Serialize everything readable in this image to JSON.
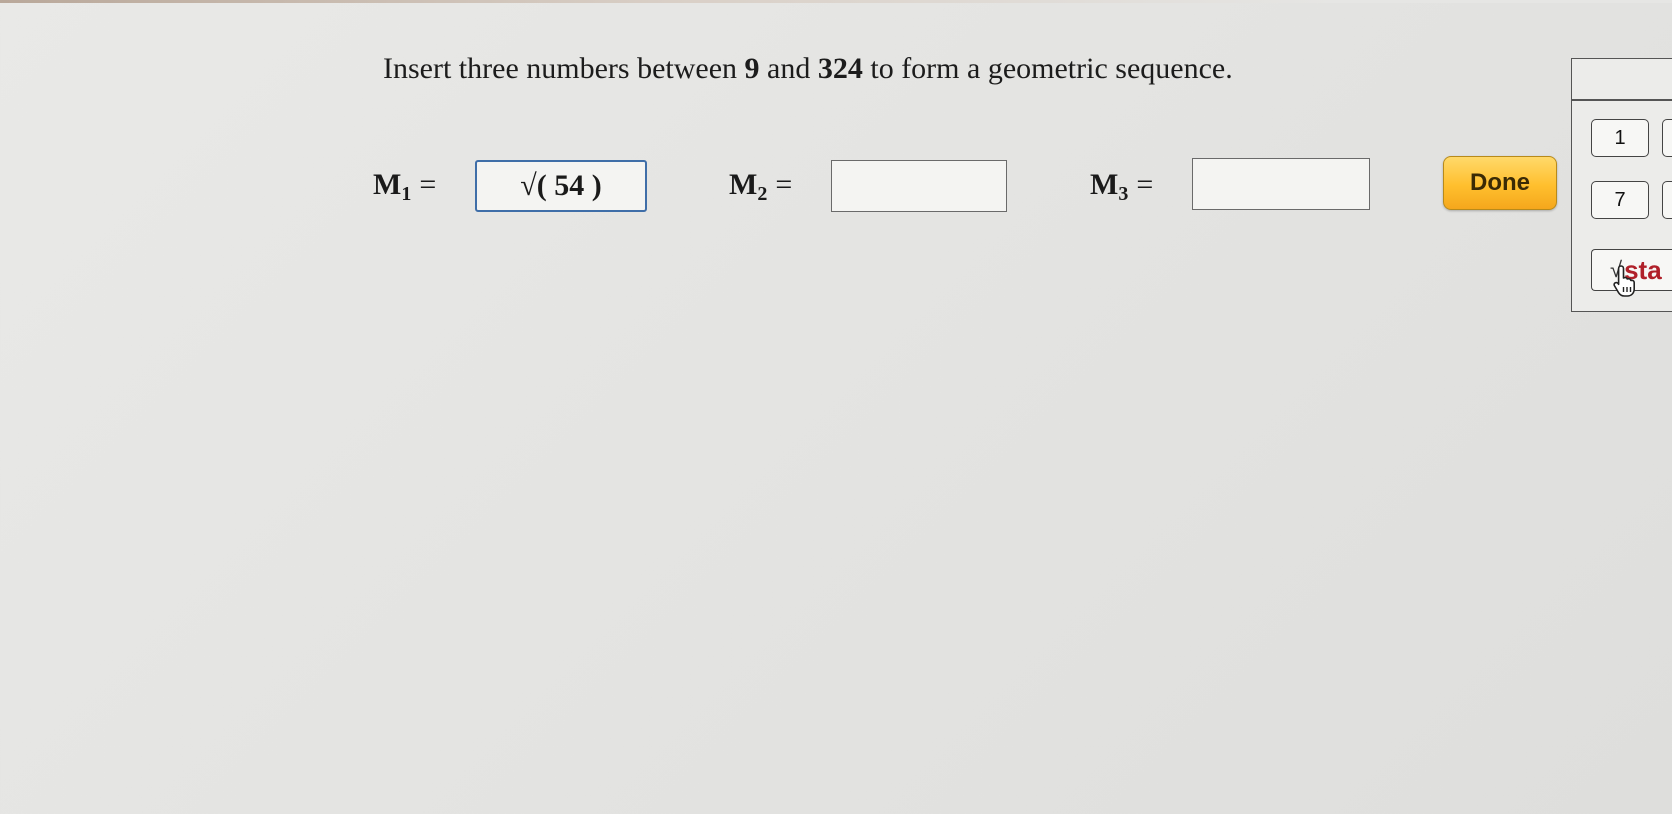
{
  "question": {
    "prefix": "Insert three numbers between ",
    "low": "9",
    "mid": " and ",
    "high": "324",
    "suffix": " to form a geometric sequence."
  },
  "answers": [
    {
      "label": "M",
      "sub": "1",
      "eq": "=",
      "value": "√( 54 )"
    },
    {
      "label": "M",
      "sub": "2",
      "eq": "=",
      "value": ""
    },
    {
      "label": "M",
      "sub": "3",
      "eq": "=",
      "value": ""
    }
  ],
  "done_button": {
    "label": "Done"
  },
  "keypad": {
    "key_1": "1",
    "key_7": "7",
    "sqrt_symbol": "√",
    "sqrt_text": "sta"
  },
  "colors": {
    "done_button": "#ffbf2e",
    "active_border": "#3f6ea8",
    "keypad_accent": "#b0212a"
  },
  "icons": [
    "hand-pointer-icon"
  ]
}
